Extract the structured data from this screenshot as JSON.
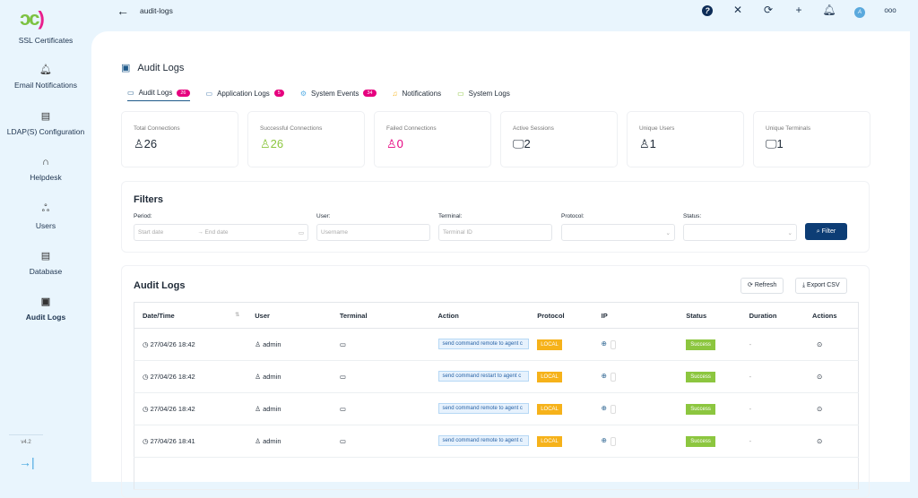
{
  "sidebar": {
    "items": [
      {
        "label": "SSL Certificates",
        "icon": "certificate-icon"
      },
      {
        "label": "Email Notifications",
        "icon": "bell-icon"
      },
      {
        "label": "LDAP(S) Configuration",
        "icon": "server-icon"
      },
      {
        "label": "Helpdesk",
        "icon": "headset-icon"
      },
      {
        "label": "Users",
        "icon": "users-icon"
      },
      {
        "label": "Database",
        "icon": "database-icon"
      },
      {
        "label": "Audit Logs",
        "icon": "audit-icon"
      }
    ],
    "version": "v4.2"
  },
  "topbar": {
    "title": "audit-logs"
  },
  "page": {
    "title": "Audit Logs"
  },
  "tabs": [
    {
      "label": "Audit Logs",
      "badge": "26",
      "active": true
    },
    {
      "label": "Application Logs",
      "badge": "5"
    },
    {
      "label": "System Events",
      "badge": "34"
    },
    {
      "label": "Notifications"
    },
    {
      "label": "System Logs"
    }
  ],
  "stats": [
    {
      "label": "Total Connections",
      "value": "26",
      "color": "#1f2a37"
    },
    {
      "label": "Successful Connections",
      "value": "26",
      "color": "#8cc63f"
    },
    {
      "label": "Failed Connections",
      "value": "0",
      "color": "#e6007e"
    },
    {
      "label": "Active Sessions",
      "value": "2",
      "color": "#1f2a37"
    },
    {
      "label": "Unique Users",
      "value": "1",
      "color": "#1f2a37"
    },
    {
      "label": "Unique Terminals",
      "value": "1",
      "color": "#1f2a37"
    }
  ],
  "filters": {
    "title": "Filters",
    "period_label": "Period:",
    "start_placeholder": "Start date",
    "end_placeholder": "End date",
    "user_label": "User:",
    "user_placeholder": "Username",
    "terminal_label": "Terminal:",
    "terminal_placeholder": "Terminal ID",
    "protocol_label": "Protocol:",
    "status_label": "Status:",
    "filter_button": "Filter"
  },
  "logs": {
    "title": "Audit Logs",
    "refresh": "Refresh",
    "export": "Export CSV",
    "columns": [
      "Date/Time",
      "User",
      "Terminal",
      "Action",
      "Protocol",
      "IP",
      "Status",
      "Duration",
      "Actions"
    ],
    "rows": [
      {
        "date": "27/04/26 18:42",
        "user": "admin",
        "action": "send command remote to agent c",
        "protocol": "LOCAL",
        "status": "Success",
        "duration": "-"
      },
      {
        "date": "27/04/26 18:42",
        "user": "admin",
        "action": "send command restart to agent c",
        "protocol": "LOCAL",
        "status": "Success",
        "duration": "-"
      },
      {
        "date": "27/04/26 18:42",
        "user": "admin",
        "action": "send command remote to agent c",
        "protocol": "LOCAL",
        "status": "Success",
        "duration": "-"
      },
      {
        "date": "27/04/26 18:41",
        "user": "admin",
        "action": "send command remote to agent c",
        "protocol": "LOCAL",
        "status": "Success",
        "duration": "-"
      }
    ]
  }
}
